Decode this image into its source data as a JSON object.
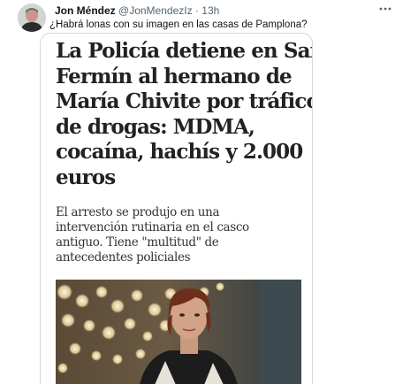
{
  "tweet": {
    "author_name": "Jon Méndez",
    "author_handle": "@JonMendezIz",
    "separator": "·",
    "time": "13h",
    "text": "¿Habrá lonas con su imagen en las casas de Pamplona?",
    "more_icon": "more-horizontal-icon"
  },
  "article": {
    "headline_lines": [
      "La Policía detiene en San",
      "Fermín al hermano de",
      "María Chivite por tráfico",
      "de drogas: MDMA,",
      "cocaína, hachís y 2.000",
      "euros"
    ],
    "subhead_lines": [
      "El arresto se produjo en una",
      "intervención rutinaria en el casco",
      "antiguo. Tiene \"multitud\" de",
      "antecedentes policiales"
    ]
  },
  "colors": {
    "text_primary": "#0f1419",
    "text_secondary": "#536471",
    "card_border": "#cfd9de",
    "headline": "#222222"
  }
}
